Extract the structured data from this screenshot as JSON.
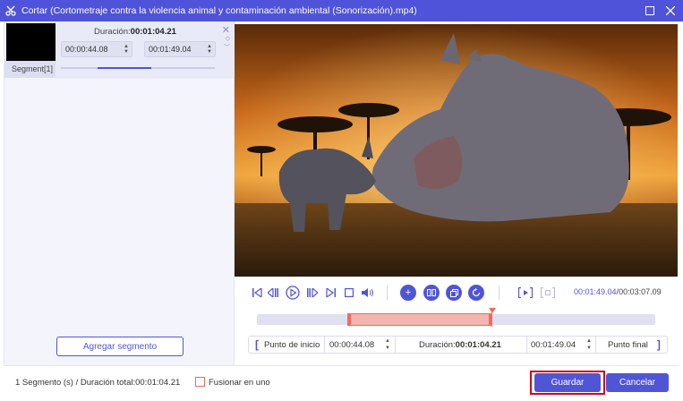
{
  "window": {
    "title": "Cortar (Cortometraje contra la violencia animal y contaminación ambiental (Sonorización).mp4)",
    "icon": "scissors-icon",
    "accent": "#4f53d9"
  },
  "segment_list": {
    "items": [
      {
        "label": "Segment[1]",
        "duration_label": "Duración:",
        "duration_value": "00:01:04.21",
        "start": "00:00:44.08",
        "end": "00:01:49.04"
      }
    ],
    "add_button": "Agregar segmento"
  },
  "player": {
    "current_time": "00:01:49.04",
    "separator": "/",
    "total_time": "00:03:07.09",
    "controls": [
      "skip-start-icon",
      "step-back-icon",
      "play-icon",
      "step-forward-icon",
      "skip-end-icon",
      "stop-icon",
      "volume-icon",
      "add-segment-icon",
      "split-icon",
      "copy-icon",
      "reset-icon",
      "preview-start-icon",
      "preview-end-icon"
    ]
  },
  "trim_bar": {
    "start_label": "Punto de inicio",
    "start_value": "00:00:44.08",
    "duration_label": "Duración:",
    "duration_value": "00:01:04.21",
    "end_value": "00:01:49.04",
    "end_label": "Punto final",
    "selection_start_fraction": 0.235,
    "selection_end_fraction": 0.583,
    "highlight_color": "#f06b5c"
  },
  "footer": {
    "total_text": "1 Segmento (s) / Duración total:00:01:04.21",
    "merge_label": "Fusionar en uno",
    "merge_checked": false,
    "save_label": "Guardar",
    "cancel_label": "Cancelar"
  }
}
